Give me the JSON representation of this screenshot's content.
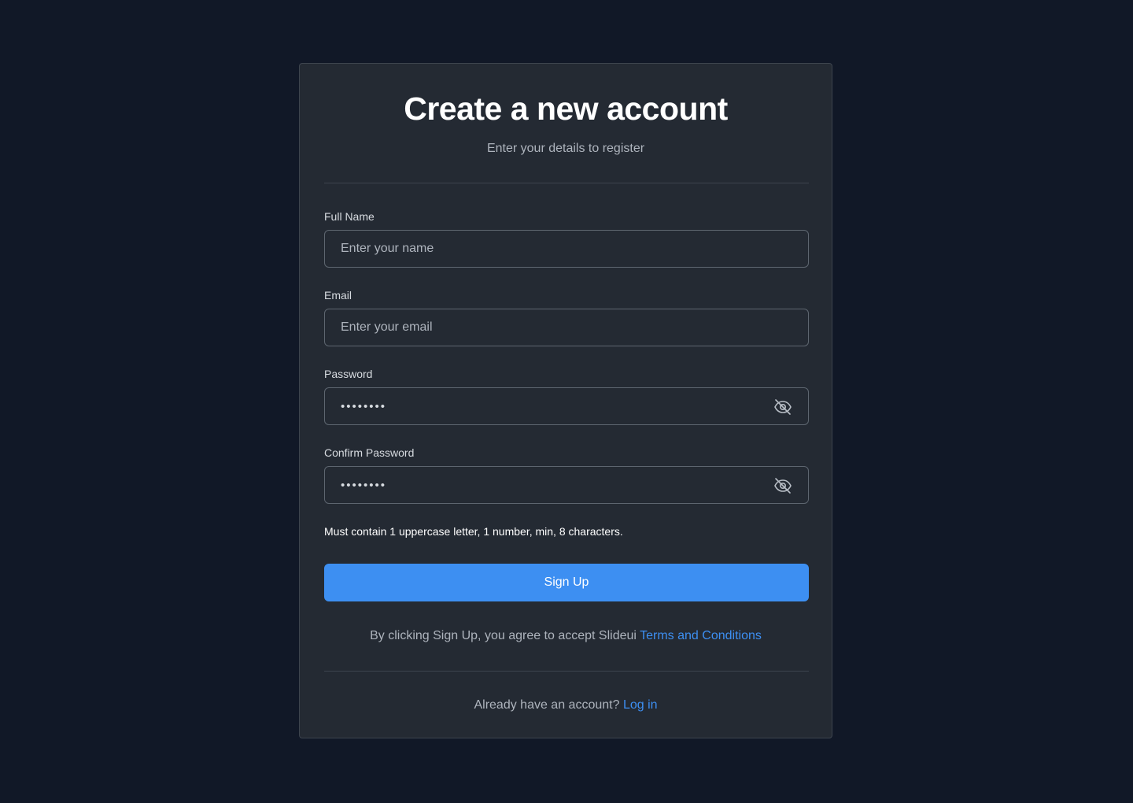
{
  "header": {
    "title": "Create a new account",
    "subtitle": "Enter your details to register"
  },
  "form": {
    "full_name": {
      "label": "Full Name",
      "placeholder": "Enter your name",
      "value": ""
    },
    "email": {
      "label": "Email",
      "placeholder": "Enter your email",
      "value": ""
    },
    "password": {
      "label": "Password",
      "value": "••••••••",
      "toggle_icon": "eye-off-icon"
    },
    "confirm_password": {
      "label": "Confirm Password",
      "value": "••••••••",
      "toggle_icon": "eye-off-icon"
    },
    "hint": "Must contain 1 uppercase letter, 1 number, min, 8 characters.",
    "submit_label": "Sign Up"
  },
  "terms": {
    "text": "By clicking Sign Up, you agree to accept Slideui ",
    "link_label": "Terms and Conditions"
  },
  "login": {
    "text": "Already have an account? ",
    "link_label": "Log in"
  },
  "colors": {
    "page_background": "#111827",
    "card_background": "#242a33",
    "accent": "#3d8ff2"
  }
}
